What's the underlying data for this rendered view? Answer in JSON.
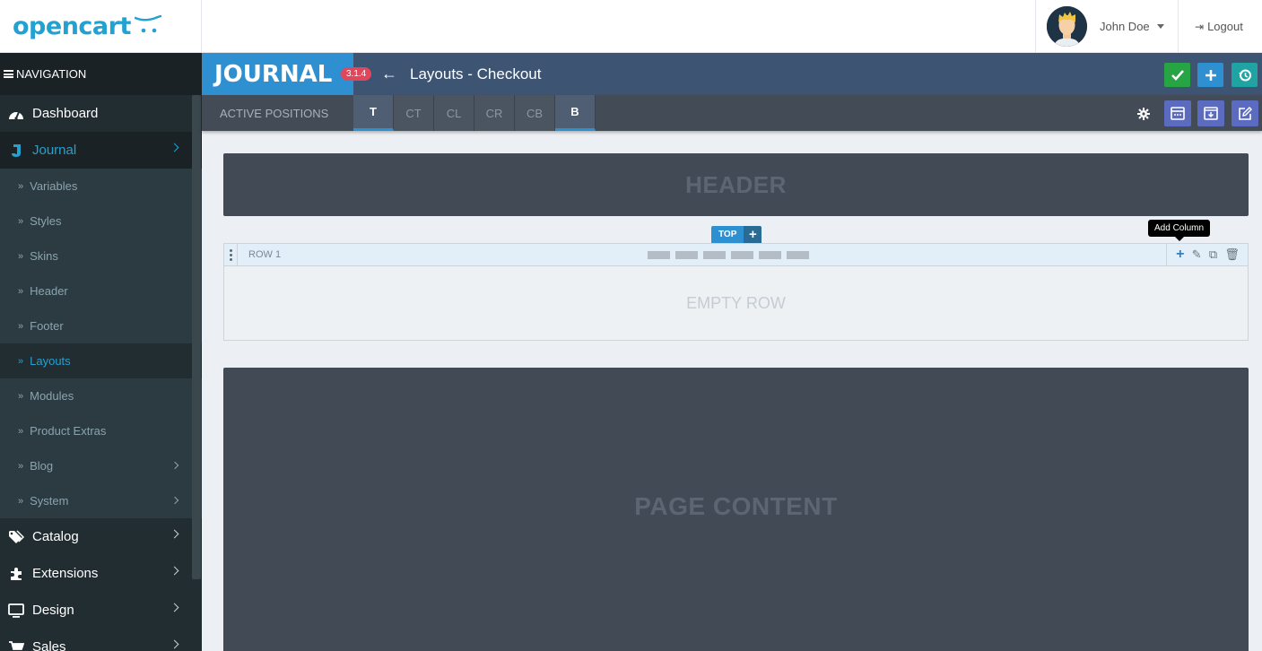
{
  "brand": {
    "logo_text": "opencart",
    "accent": "#23a1d1"
  },
  "user": {
    "name": "John Doe",
    "logout_label": "Logout"
  },
  "sidebar": {
    "nav_heading": "NAVIGATION",
    "items": [
      {
        "label": "Dashboard",
        "icon": "dashboard-icon"
      },
      {
        "label": "Journal",
        "icon": "journal-j-icon",
        "active": true
      },
      {
        "label": "Catalog",
        "icon": "tags-icon"
      },
      {
        "label": "Extensions",
        "icon": "puzzle-icon"
      },
      {
        "label": "Design",
        "icon": "monitor-icon"
      },
      {
        "label": "Sales",
        "icon": "cart-icon"
      }
    ],
    "journal_sub": [
      {
        "label": "Variables"
      },
      {
        "label": "Styles"
      },
      {
        "label": "Skins"
      },
      {
        "label": "Header"
      },
      {
        "label": "Footer"
      },
      {
        "label": "Layouts",
        "active": true
      },
      {
        "label": "Modules"
      },
      {
        "label": "Product Extras"
      },
      {
        "label": "Blog",
        "has_children": true
      },
      {
        "label": "System",
        "has_children": true
      }
    ]
  },
  "journal_bar": {
    "logo_text": "JOURNAL",
    "version": "3.1.4",
    "title": "Layouts - Checkout",
    "buttons": [
      {
        "name": "save",
        "icon": "check-icon",
        "color": "#27a544"
      },
      {
        "name": "add",
        "icon": "plus-icon",
        "color": "#2f90d1"
      },
      {
        "name": "history",
        "icon": "history-icon",
        "color": "#1fa3a3"
      }
    ]
  },
  "positions_bar": {
    "label": "ACTIVE POSITIONS",
    "tabs": [
      {
        "label": "T",
        "active": true
      },
      {
        "label": "CT",
        "active": false
      },
      {
        "label": "CL",
        "active": false
      },
      {
        "label": "CR",
        "active": false
      },
      {
        "label": "CB",
        "active": false
      },
      {
        "label": "B",
        "active": true
      }
    ],
    "tools": [
      {
        "icon": "gear-icon",
        "color": "#424b56"
      },
      {
        "icon": "window-icon",
        "color": "#5b6bc0"
      },
      {
        "icon": "download-icon",
        "color": "#5b6bc0"
      },
      {
        "icon": "edit-icon",
        "color": "#5b6bc0"
      }
    ]
  },
  "layout": {
    "header_label": "HEADER",
    "top_label": "TOP",
    "row_label": "ROW 1",
    "empty_row_label": "EMPTY ROW",
    "tooltip": "Add Column",
    "page_content_label": "PAGE CONTENT"
  }
}
